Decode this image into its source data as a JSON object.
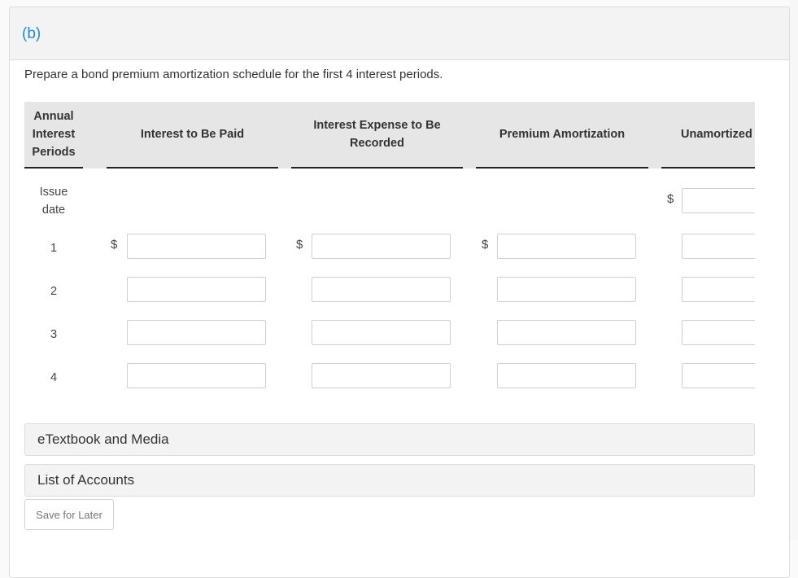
{
  "part": {
    "label": "(b)"
  },
  "instruction": "Prepare a bond premium amortization schedule for the first 4 interest periods.",
  "table": {
    "columns": [
      {
        "id": "period",
        "label_lines": [
          "Annual",
          "Interest",
          "Periods"
        ]
      },
      {
        "id": "interest_paid",
        "label": "Interest to Be Paid"
      },
      {
        "id": "interest_expense",
        "label_lines": [
          "Interest Expense to Be",
          "Recorded"
        ]
      },
      {
        "id": "premium_amortization",
        "label": "Premium Amortization"
      },
      {
        "id": "unamortized_premium",
        "label": "Unamortized P"
      }
    ],
    "currency_symbol": "$",
    "rows": [
      {
        "label_lines": [
          "Issue",
          "date"
        ],
        "interest_paid": null,
        "interest_expense": null,
        "premium_amortization": null,
        "unamortized_premium": ""
      },
      {
        "label": "1",
        "interest_paid": "",
        "interest_expense": "",
        "premium_amortization": "",
        "unamortized_premium": ""
      },
      {
        "label": "2",
        "interest_paid": "",
        "interest_expense": "",
        "premium_amortization": "",
        "unamortized_premium": ""
      },
      {
        "label": "3",
        "interest_paid": "",
        "interest_expense": "",
        "premium_amortization": "",
        "unamortized_premium": ""
      },
      {
        "label": "4",
        "interest_paid": "",
        "interest_expense": "",
        "premium_amortization": "",
        "unamortized_premium": ""
      }
    ]
  },
  "resources": [
    {
      "label": "eTextbook and Media"
    },
    {
      "label": "List of Accounts"
    }
  ],
  "buttons": {
    "save_for_later": "Save for Later"
  },
  "colors": {
    "accent": "#1a8fd6",
    "header_bg": "#e6e6e6",
    "panel_head_bg": "#f3f3f3"
  }
}
